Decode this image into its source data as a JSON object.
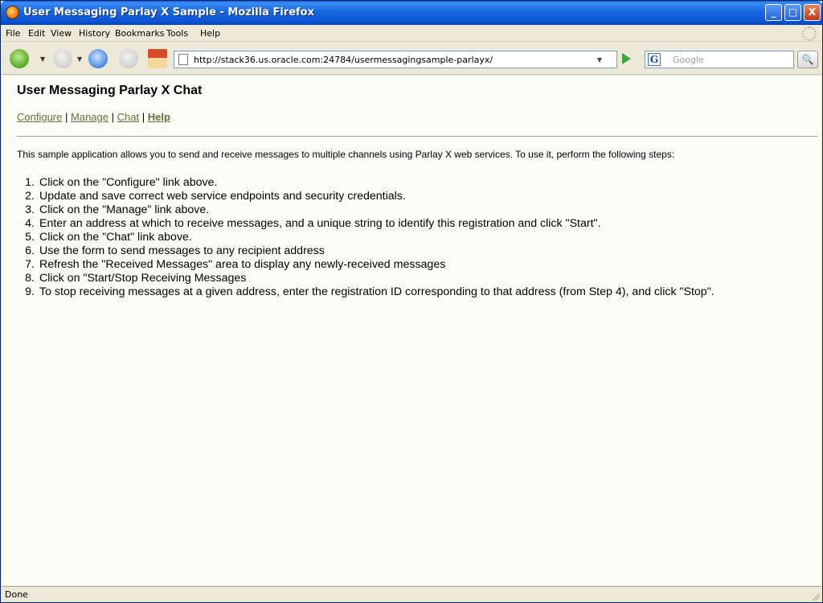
{
  "window": {
    "title": "User Messaging Parlay X Sample - Mozilla Firefox",
    "controls": {
      "minimize": "_",
      "maximize": "□",
      "close": "X"
    }
  },
  "menu": [
    {
      "label": "File"
    },
    {
      "label": "Edit"
    },
    {
      "label": "View"
    },
    {
      "label": "History"
    },
    {
      "label": "Bookmarks"
    },
    {
      "label": "Tools"
    },
    {
      "label": "Help"
    }
  ],
  "toolbar": {
    "url": "http://stack36.us.oracle.com:24784/usermessagingsample-parlayx/",
    "search_placeholder": "Google",
    "search_engine_letter": "G"
  },
  "page": {
    "title": "User Messaging Parlay X Chat",
    "nav": [
      {
        "label": "Configure",
        "active": false
      },
      {
        "label": "Manage",
        "active": false
      },
      {
        "label": "Chat",
        "active": false
      },
      {
        "label": "Help",
        "active": true
      }
    ],
    "separator": "|",
    "intro": "This sample application allows you to send and receive messages to multiple channels using Parlay X web services. To use it, perform the following steps:",
    "steps": [
      {
        "num": "1.",
        "text": "Click on the \"Configure\" link above."
      },
      {
        "num": "2.",
        "text": "Update and save correct web service endpoints and security credentials."
      },
      {
        "num": "3.",
        "text": "Click on the \"Manage\" link above."
      },
      {
        "num": "4.",
        "text": "Enter an address at which to receive messages, and a unique string to identify this registration and click \"Start\"."
      },
      {
        "num": "5.",
        "text": "Click on the \"Chat\" link above."
      },
      {
        "num": "6.",
        "text": "Use the form to send messages to any recipient address"
      },
      {
        "num": "7.",
        "text": "Refresh the \"Received Messages\" area to display any newly-received messages"
      },
      {
        "num": "8.",
        "text": "Click on \"Start/Stop Receiving Messages"
      },
      {
        "num": "9.",
        "text": "To stop receiving messages at a given address, enter the registration ID corresponding to that address (from Step 4), and click \"Stop\"."
      }
    ]
  },
  "status": {
    "text": "Done"
  },
  "colors": {
    "link": "#6b6b3b",
    "titlebar": "#0b54d4",
    "content_bg": "#fcfcf7"
  }
}
